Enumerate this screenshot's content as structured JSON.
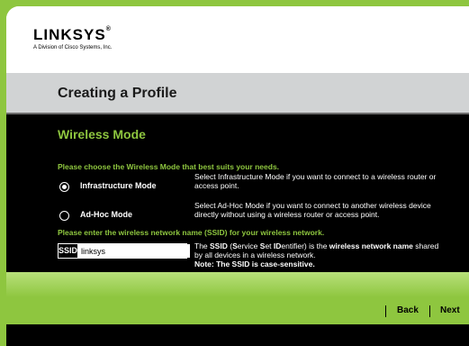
{
  "brand": {
    "name": "LINKSYS",
    "mark": "®",
    "subtitle": "A Division of Cisco Systems, Inc."
  },
  "page_title": "Creating a Profile",
  "section_title": "Wireless Mode",
  "instruction_mode": "Please choose the Wireless Mode that best suits your needs.",
  "modes": [
    {
      "label": "Infrastructure Mode",
      "selected": true,
      "description": "Select Infrastructure Mode if you want to connect to a wireless router or access point."
    },
    {
      "label": "Ad-Hoc Mode",
      "selected": false,
      "description": "Select Ad-Hoc Mode if you want to connect to another wireless device directly without using a wireless router or access point."
    }
  ],
  "instruction_ssid": "Please enter the wireless network name (SSID) for your wireless network.",
  "ssid": {
    "label": "SSID",
    "value": "linksys"
  },
  "ssid_help": {
    "part1": "The ",
    "ssid_word": "SSID",
    "part2": " (",
    "s": "S",
    "ervice": "ervice ",
    "s2": "S",
    "et": "et ",
    "id": "ID",
    "entifier": "entifier) is the ",
    "bold_name": "wireless network name",
    "part3": " shared by all devices in a wireless network.",
    "note": "Note: The SSID is case-sensitive."
  },
  "nav": {
    "back": "Back",
    "next": "Next"
  }
}
